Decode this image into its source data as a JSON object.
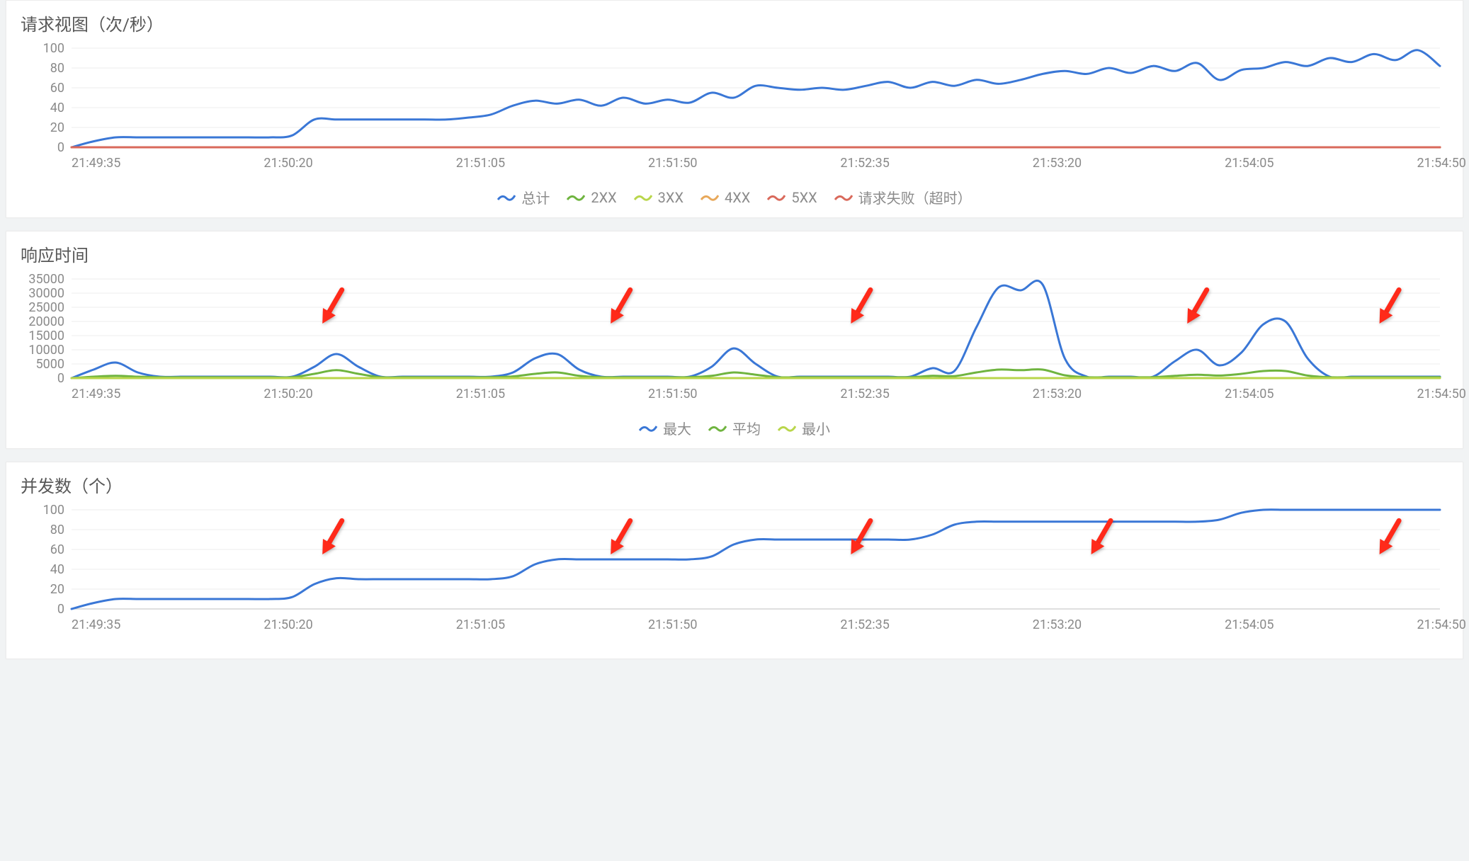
{
  "colors": {
    "blue": "#3a77d6",
    "green": "#6fb43f",
    "lime": "#b9d64b",
    "orange": "#e8a85a",
    "red": "#d9695b"
  },
  "x_ticks": [
    "21:49:35",
    "21:50:20",
    "21:51:05",
    "21:51:50",
    "21:52:35",
    "21:53:20",
    "21:54:05",
    "21:54:50"
  ],
  "chart_data": [
    {
      "id": "requests",
      "type": "line",
      "title": "请求视图（次/秒）",
      "ylabel": "",
      "xlabel": "",
      "y_ticks": [
        0,
        20,
        40,
        60,
        80,
        100
      ],
      "ylim": [
        0,
        100
      ],
      "x": "shared_x_ticks",
      "legend": [
        {
          "name": "总计",
          "color": "blue"
        },
        {
          "name": "2XX",
          "color": "green"
        },
        {
          "name": "3XX",
          "color": "lime"
        },
        {
          "name": "4XX",
          "color": "orange"
        },
        {
          "name": "5XX",
          "color": "red"
        },
        {
          "name": "请求失败（超时）",
          "color": "red"
        }
      ],
      "series": [
        {
          "name": "总计",
          "color": "blue",
          "values": [
            0,
            6,
            10,
            10,
            10,
            10,
            10,
            10,
            10,
            10,
            12,
            28,
            28,
            28,
            28,
            28,
            28,
            28,
            30,
            33,
            42,
            47,
            44,
            48,
            42,
            50,
            44,
            48,
            45,
            55,
            50,
            62,
            60,
            58,
            60,
            58,
            62,
            66,
            60,
            66,
            62,
            68,
            64,
            68,
            74,
            77,
            74,
            80,
            75,
            82,
            77,
            85,
            68,
            78,
            80,
            86,
            82,
            90,
            86,
            94,
            88,
            98,
            82
          ]
        },
        {
          "name": "2XX",
          "color": "green",
          "values": "flat_zero"
        },
        {
          "name": "3XX",
          "color": "lime",
          "values": "flat_zero"
        },
        {
          "name": "4XX",
          "color": "orange",
          "values": "flat_zero"
        },
        {
          "name": "5XX",
          "color": "red",
          "values": "flat_zero"
        },
        {
          "name": "请求失败（超时）",
          "color": "red",
          "values": "flat_zero"
        }
      ]
    },
    {
      "id": "response_time",
      "type": "line",
      "title": "响应时间",
      "ylabel": "",
      "xlabel": "",
      "y_ticks": [
        0,
        5000,
        10000,
        15000,
        20000,
        25000,
        30000,
        35000
      ],
      "ylim": [
        0,
        35000
      ],
      "x": "shared_x_ticks",
      "legend": [
        {
          "name": "最大",
          "color": "blue"
        },
        {
          "name": "平均",
          "color": "green"
        },
        {
          "name": "最小",
          "color": "lime"
        }
      ],
      "arrows_at_categories": [
        "21:50:20+",
        "21:51:50-",
        "21:52:35",
        "21:54:05-",
        "21:54:50-"
      ],
      "series": [
        {
          "name": "最大",
          "color": "blue",
          "values": [
            0,
            3000,
            5500,
            2000,
            500,
            500,
            500,
            500,
            500,
            500,
            500,
            4000,
            8500,
            4000,
            500,
            500,
            500,
            500,
            500,
            500,
            2000,
            7000,
            8500,
            3000,
            500,
            500,
            500,
            500,
            500,
            4000,
            10500,
            5000,
            500,
            500,
            500,
            500,
            500,
            500,
            500,
            3500,
            2500,
            18000,
            32000,
            31000,
            33000,
            7000,
            500,
            500,
            500,
            500,
            6000,
            10000,
            4500,
            9000,
            19000,
            20000,
            7000,
            500,
            500,
            500,
            500,
            500,
            500
          ]
        },
        {
          "name": "平均",
          "color": "green",
          "values": [
            0,
            500,
            800,
            500,
            300,
            300,
            300,
            300,
            300,
            300,
            300,
            1500,
            2800,
            1500,
            300,
            300,
            300,
            300,
            300,
            300,
            600,
            1500,
            2000,
            800,
            300,
            300,
            300,
            300,
            300,
            800,
            2000,
            1200,
            300,
            300,
            300,
            300,
            300,
            300,
            300,
            800,
            700,
            2000,
            3000,
            2800,
            3000,
            1000,
            300,
            300,
            300,
            300,
            800,
            1200,
            900,
            1500,
            2500,
            2500,
            900,
            300,
            300,
            300,
            300,
            300,
            300
          ]
        },
        {
          "name": "最小",
          "color": "lime",
          "values": "flat_zero"
        }
      ]
    },
    {
      "id": "concurrency",
      "type": "line",
      "title": "并发数（个）",
      "ylabel": "",
      "xlabel": "",
      "y_ticks": [
        0,
        20,
        40,
        60,
        80,
        100
      ],
      "ylim": [
        0,
        100
      ],
      "x": "shared_x_ticks",
      "legend": [],
      "arrows_at_categories": [
        "21:50:20+",
        "21:51:50-",
        "21:52:35",
        "21:53:20+",
        "21:54:50-"
      ],
      "series": [
        {
          "name": "并发",
          "color": "blue",
          "values": [
            0,
            6,
            10,
            10,
            10,
            10,
            10,
            10,
            10,
            10,
            12,
            25,
            31,
            30,
            30,
            30,
            30,
            30,
            30,
            30,
            33,
            45,
            50,
            50,
            50,
            50,
            50,
            50,
            50,
            53,
            65,
            70,
            70,
            70,
            70,
            70,
            70,
            70,
            70,
            75,
            85,
            88,
            88,
            88,
            88,
            88,
            88,
            88,
            88,
            88,
            88,
            88,
            90,
            97,
            100,
            100,
            100,
            100,
            100,
            100,
            100,
            100,
            100
          ]
        }
      ]
    }
  ]
}
